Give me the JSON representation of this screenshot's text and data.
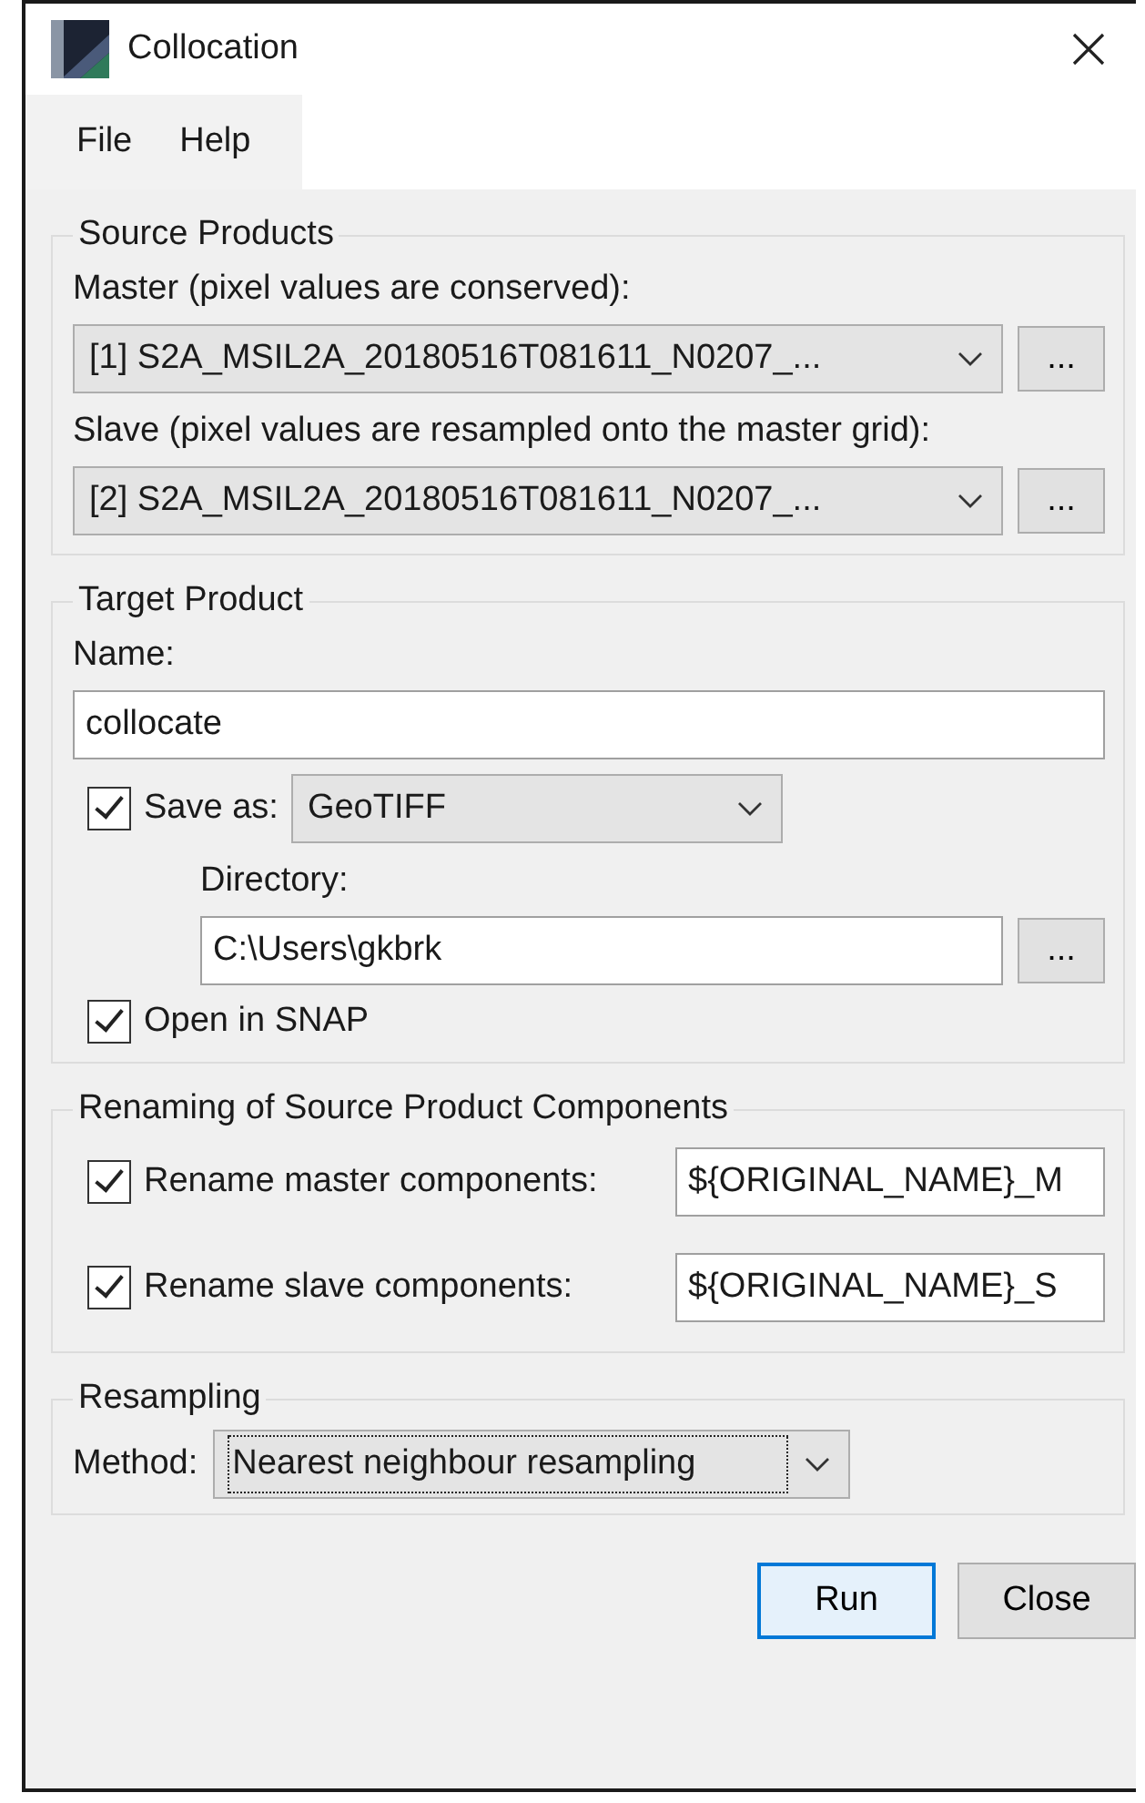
{
  "window": {
    "title": "Collocation"
  },
  "menu": [
    "File",
    "Help"
  ],
  "source_products": {
    "title": "Source Products",
    "fields": [
      {
        "label": "Master (pixel values are conserved):",
        "value": "[1] S2A_MSIL2A_20180516T081611_N0207_...",
        "browse": "..."
      },
      {
        "label": "Slave (pixel values are resampled onto the master grid):",
        "value": "[2] S2A_MSIL2A_20180516T081611_N0207_...",
        "browse": "..."
      }
    ]
  },
  "target_product": {
    "title": "Target Product",
    "name_label": "Name:",
    "name_value": "collocate",
    "save_as": {
      "checked": true,
      "label": "Save as:",
      "format": "GeoTIFF"
    },
    "directory": {
      "label": "Directory:",
      "value": "C:\\Users\\gkbrk",
      "browse": "..."
    },
    "open_in_snap": {
      "checked": true,
      "label": "Open in SNAP"
    }
  },
  "renaming": {
    "title": "Renaming of Source Product Components",
    "rows": [
      {
        "checked": true,
        "label": "Rename master components:",
        "value": "${ORIGINAL_NAME}_M"
      },
      {
        "checked": true,
        "label": "Rename slave components:",
        "value": "${ORIGINAL_NAME}_S"
      }
    ]
  },
  "resampling": {
    "title": "Resampling",
    "method_label": "Method:",
    "method": "Nearest neighbour resampling",
    "focused": true
  },
  "buttons": [
    {
      "label": "Run",
      "default": true
    },
    {
      "label": "Close",
      "default": false
    }
  ]
}
